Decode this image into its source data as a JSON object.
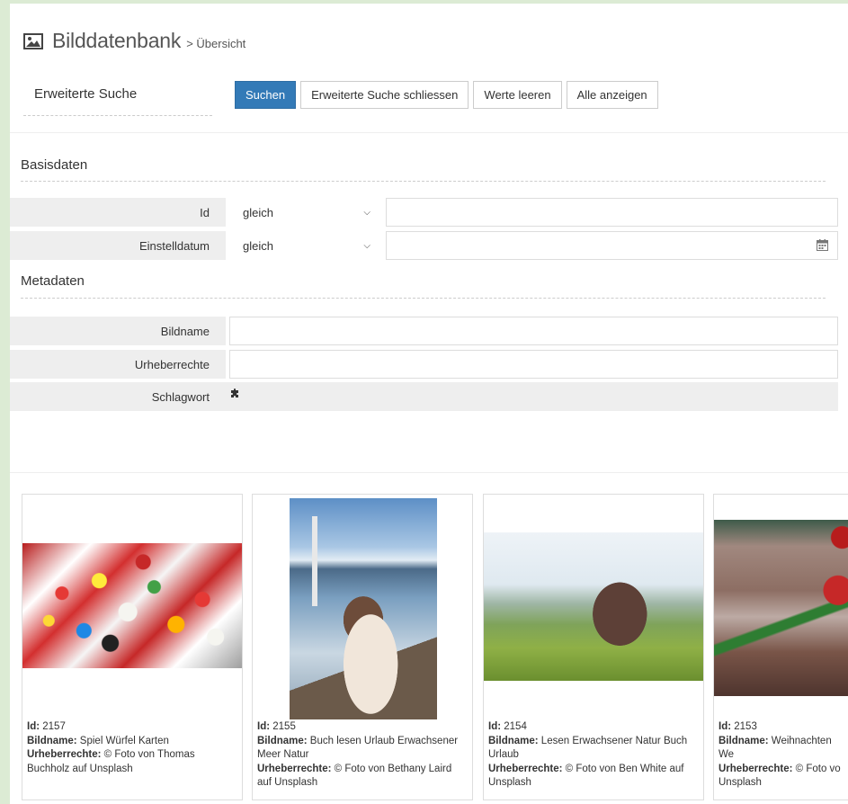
{
  "header": {
    "title": "Bilddatenbank",
    "breadcrumb": "> Übersicht",
    "icon": "image-icon"
  },
  "search": {
    "label": "Erweiterte Suche",
    "buttons": {
      "search": "Suchen",
      "close": "Erweiterte Suche schliessen",
      "clear": "Werte leeren",
      "show_all": "Alle anzeigen"
    }
  },
  "basis": {
    "title": "Basisdaten",
    "id": {
      "label": "Id",
      "operator": "gleich",
      "value": ""
    },
    "date": {
      "label": "Einstelldatum",
      "operator": "gleich",
      "value": ""
    }
  },
  "meta": {
    "title": "Metadaten",
    "name": {
      "label": "Bildname",
      "value": ""
    },
    "rights": {
      "label": "Urheberrechte",
      "value": ""
    },
    "keyword": {
      "label": "Schlagwort"
    }
  },
  "results": [
    {
      "id_label": "Id:",
      "id": "2157",
      "name_label": "Bildname:",
      "name": "Spiel Würfel Karten",
      "rights_label": "Urheberrechte:",
      "rights": "© Foto von Thomas Buchholz auf Unsplash"
    },
    {
      "id_label": "Id:",
      "id": "2155",
      "name_label": "Bildname:",
      "name": "Buch lesen Urlaub Erwachsener Meer Natur",
      "rights_label": "Urheberrechte:",
      "rights": "© Foto von Bethany Laird auf Unsplash"
    },
    {
      "id_label": "Id:",
      "id": "2154",
      "name_label": "Bildname:",
      "name": "Lesen Erwachsener Natur Buch Urlaub",
      "rights_label": "Urheberrechte:",
      "rights": "© Foto von Ben White auf Unsplash"
    },
    {
      "id_label": "Id:",
      "id": "2153",
      "name_label": "Bildname:",
      "name": "Weihnachten We",
      "rights_label": "Urheberrechte:",
      "rights": "© Foto vo Unsplash"
    }
  ],
  "colors": {
    "primary": "#337ab7",
    "page_bg": "#dcebd4",
    "label_bg": "#eeeeee"
  }
}
